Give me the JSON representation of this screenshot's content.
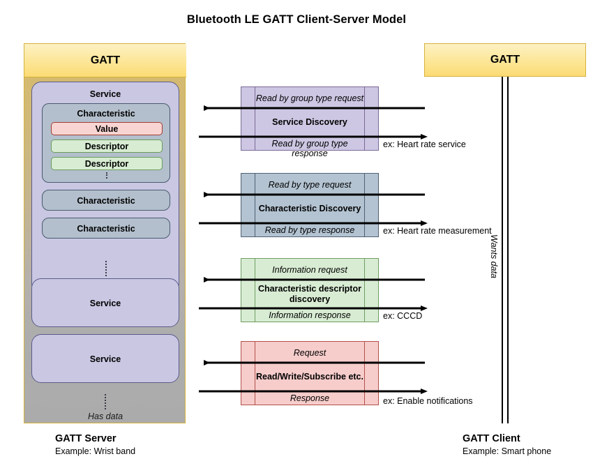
{
  "title": "Bluetooth LE GATT Client-Server Model",
  "server": {
    "header": "GATT",
    "services": [
      {
        "label": "Service",
        "characteristics": [
          {
            "label": "Characteristic",
            "items": [
              {
                "label": "Value",
                "kind": "value"
              },
              {
                "label": "Descriptor",
                "kind": "descriptor"
              },
              {
                "label": "Descriptor",
                "kind": "descriptor"
              }
            ]
          },
          {
            "label": "Characteristic",
            "items": []
          },
          {
            "label": "Characteristic",
            "items": []
          }
        ]
      },
      {
        "label": "Service",
        "characteristics": []
      },
      {
        "label": "Service",
        "characteristics": []
      }
    ],
    "footnote": "Has data",
    "caption_title": "GATT Server",
    "caption_sub": "Example: Wrist band"
  },
  "client": {
    "header": "GATT",
    "link_label": "Wants data",
    "caption_title": "GATT Client",
    "caption_sub": "Example: Smart phone"
  },
  "messages": [
    {
      "request": "Read by group type request",
      "middle": "Service Discovery",
      "response": "Read by group type response",
      "example": "ex: Heart rate service",
      "fill": "#cdc7e3",
      "stroke": "#7a6a96"
    },
    {
      "request": "Read by type request",
      "middle": "Characteristic Discovery",
      "response": "Read by type response",
      "example": "ex: Heart rate measurement",
      "fill": "#b3c3d1",
      "stroke": "#4d5f72"
    },
    {
      "request": "Information request",
      "middle": "Characteristic descriptor discovery",
      "response": "Information response",
      "example": "ex: CCCD",
      "fill": "#d8ecd3",
      "stroke": "#6f9d61"
    },
    {
      "request": "Request",
      "middle": "Read/Write/Subscribe etc.",
      "response": "Response",
      "example": "ex: Enable notifications",
      "fill": "#f6cdcb",
      "stroke": "#b3504a"
    }
  ],
  "colors": {
    "header_gold": "#fce89e",
    "header_border": "#d6b23c",
    "service_fill": "#c9c7e2",
    "characteristic_fill": "#b3bfcc",
    "value_fill": "#f8d5d2",
    "descriptor_fill": "#d7ecd2",
    "arrow": "#000000"
  }
}
